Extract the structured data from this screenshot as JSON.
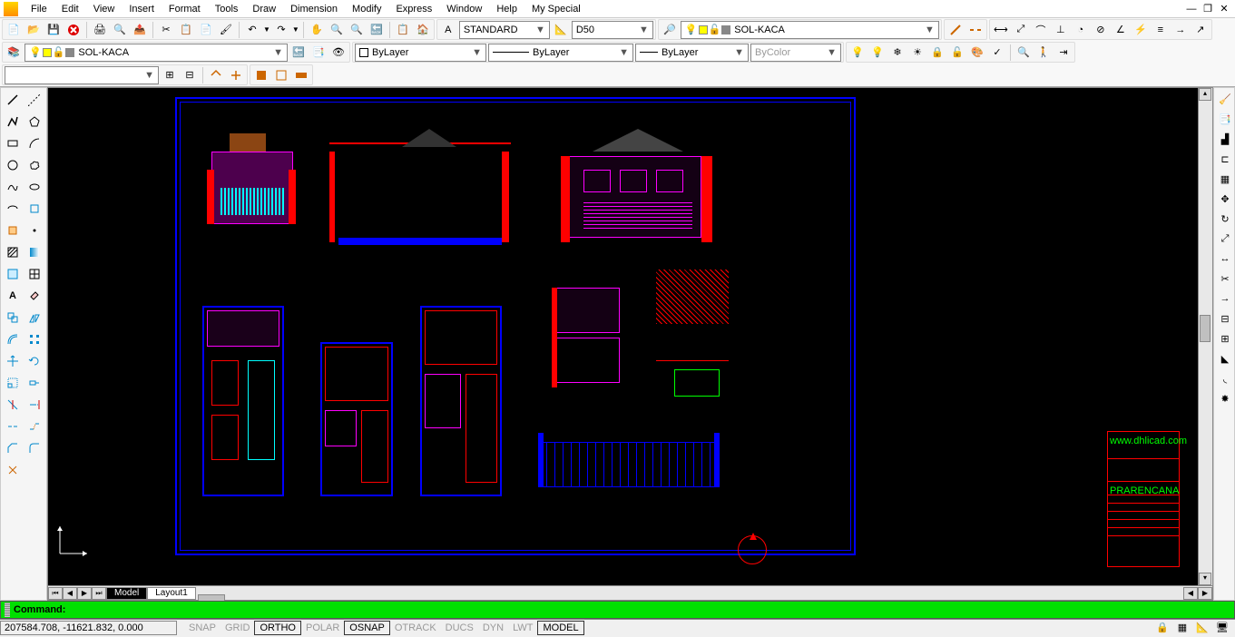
{
  "menu": [
    "File",
    "Edit",
    "View",
    "Insert",
    "Format",
    "Tools",
    "Draw",
    "Dimension",
    "Modify",
    "Express",
    "Window",
    "Help",
    "My Special"
  ],
  "toolbar": {
    "text_style": "STANDARD",
    "dim_style": "D50",
    "current_layer_label": "SOL-KACA",
    "layer_combo": "SOL-KACA",
    "color": "ByLayer",
    "linetype": "ByLayer",
    "lineweight": "ByLayer",
    "plotstyle": "ByColor"
  },
  "tabs": {
    "model": "Model",
    "layout1": "Layout1"
  },
  "command": {
    "prompt": "Command:"
  },
  "status": {
    "coords": "207584.708, -11621.832, 0.000",
    "toggles": [
      "SNAP",
      "GRID",
      "ORTHO",
      "POLAR",
      "OSNAP",
      "OTRACK",
      "DUCS",
      "DYN",
      "LWT",
      "MODEL"
    ],
    "active": [
      "ORTHO",
      "OSNAP",
      "MODEL"
    ]
  },
  "drawing": {
    "website": "www.dhlicad.com",
    "title": "PRARENCANA"
  }
}
